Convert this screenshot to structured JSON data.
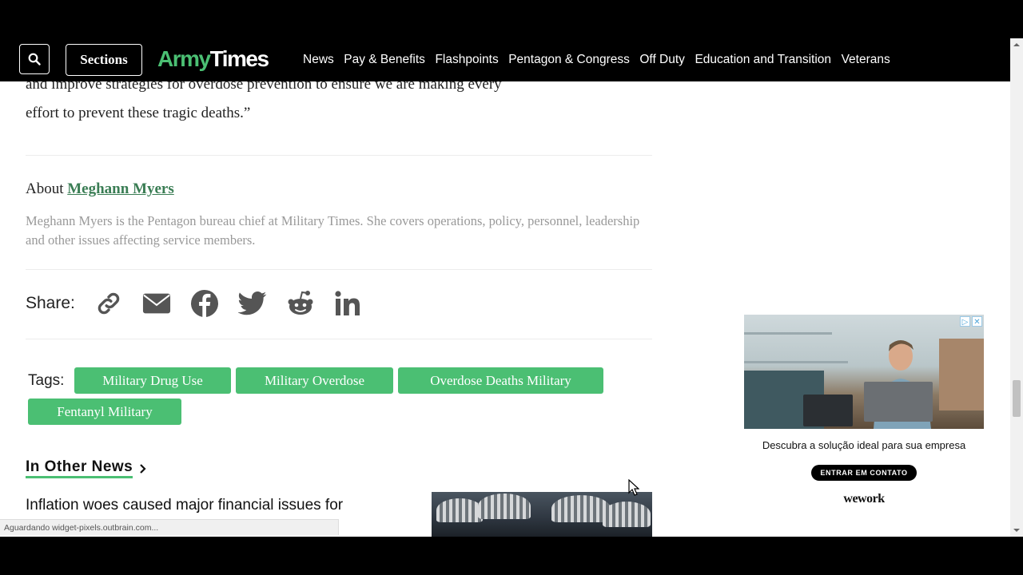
{
  "header": {
    "sections_label": "Sections",
    "logo_army": "Army",
    "logo_times": "Times",
    "nav": [
      "News",
      "Pay & Benefits",
      "Flashpoints",
      "Pentagon & Congress",
      "Off Duty",
      "Education and Transition",
      "Veterans"
    ]
  },
  "article": {
    "para_line1": "and improve strategies for overdose prevention to ensure we are making every",
    "para_line2": "effort to prevent these tragic deaths.”",
    "about_prefix": "About ",
    "author_name": "Meghann Myers",
    "bio": "Meghann Myers is the Pentagon bureau chief at Military Times. She covers operations, policy, personnel, leadership and other issues affecting service members.",
    "share_label": "Share:",
    "share_icons": [
      "link-icon",
      "email-icon",
      "facebook-icon",
      "twitter-icon",
      "reddit-icon",
      "linkedin-icon"
    ],
    "tags_label": "Tags:",
    "tags": [
      "Military Drug Use",
      "Military Overdose",
      "Overdose Deaths Military",
      "Fentanyl Military"
    ],
    "other_news_label": "In Other News",
    "news_headline": "Inflation woes caused major financial issues for"
  },
  "ad": {
    "caption": "Descubra a solução ideal para sua empresa",
    "cta": "ENTRAR EM CONTATO",
    "brand": "wework"
  },
  "status_bar": "Aguardando widget-pixels.outbrain.com...",
  "colors": {
    "accent_green": "#4bbf73",
    "link_green": "#3a7d54",
    "header_bg": "#000000"
  }
}
